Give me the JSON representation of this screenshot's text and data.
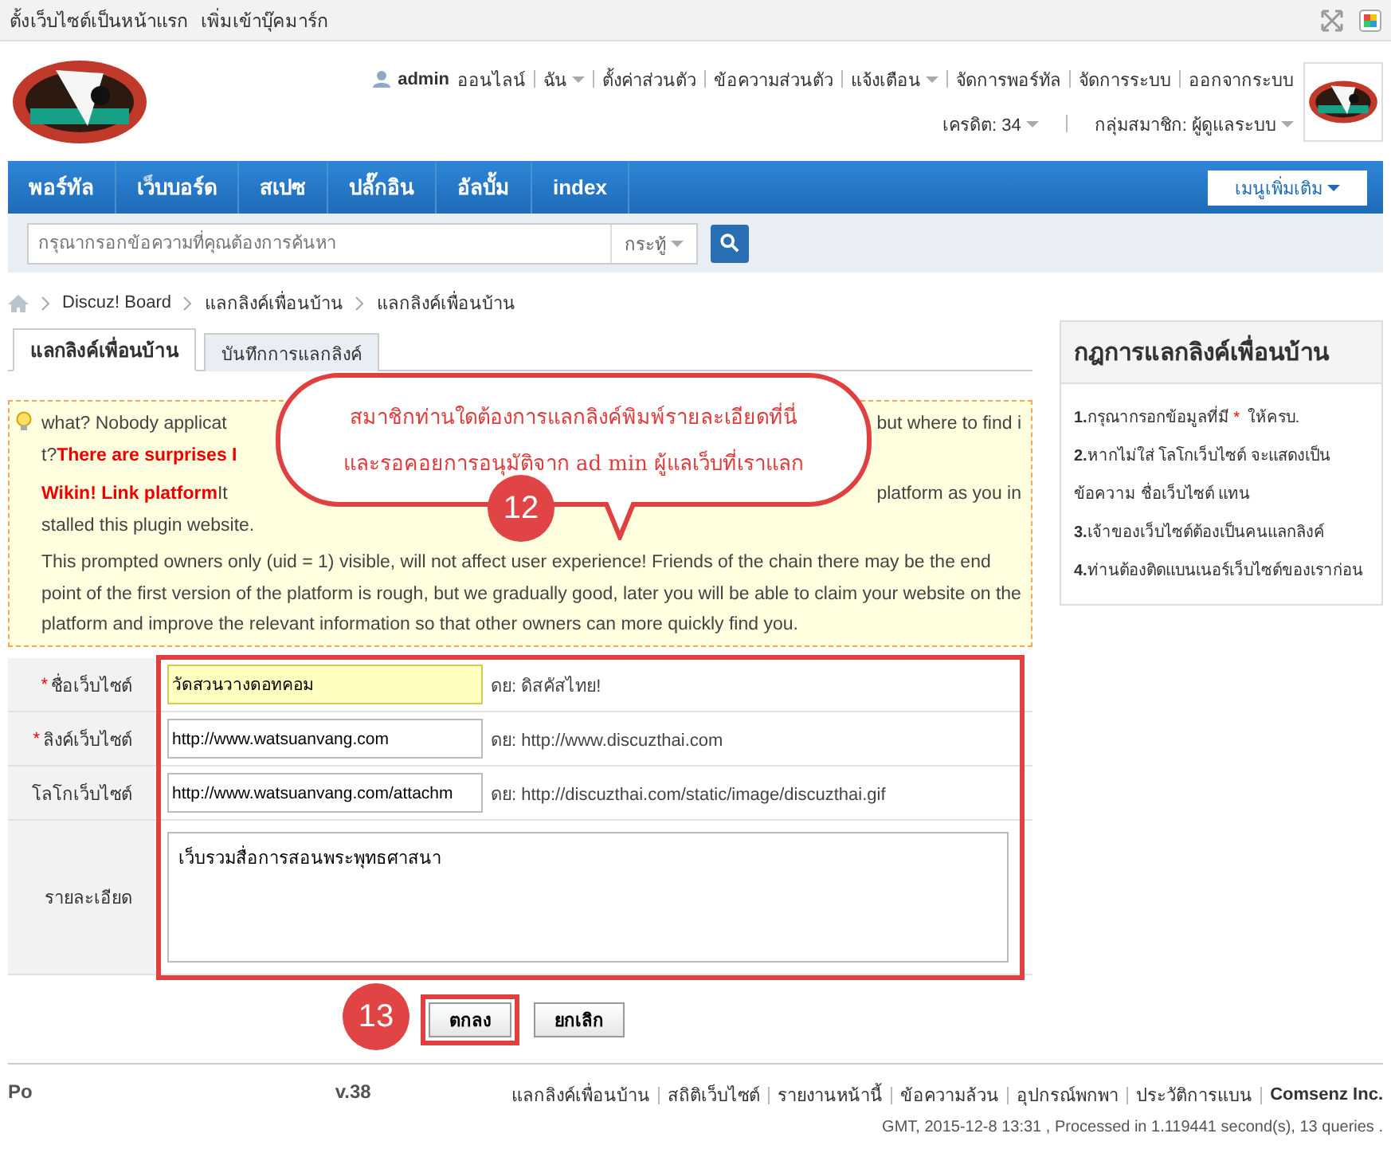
{
  "top_bar": {
    "links": [
      "ตั้งเว็บไซต์เป็นหน้าแรก",
      "เพิ่มเข้าบุ๊คมาร์ก"
    ]
  },
  "user_bar": {
    "username": "admin",
    "status": "ออนไลน์",
    "links": [
      {
        "label": "ฉัน",
        "dropdown": true
      },
      {
        "label": "ตั้งค่าส่วนตัว",
        "dropdown": false
      },
      {
        "label": "ข้อความส่วนตัว",
        "dropdown": false
      },
      {
        "label": "แจ้งเตือน",
        "dropdown": true
      },
      {
        "label": "จัดการพอร์ทัล",
        "dropdown": false
      },
      {
        "label": "จัดการระบบ",
        "dropdown": false
      },
      {
        "label": "ออกจากระบบ",
        "dropdown": false
      }
    ],
    "credit": "เครดิต: 34",
    "group": "กลุ่มสมาชิก: ผู้ดูแลระบบ"
  },
  "nav": {
    "items": [
      "พอร์ทัล",
      "เว็บบอร์ด",
      "สเปซ",
      "ปลั๊กอิน",
      "อัลบั้ม",
      "index"
    ],
    "more": "เมนูเพิ่มเติม"
  },
  "search": {
    "placeholder": "กรุณากรอกข้อความที่คุณต้องการค้นหา",
    "scope": "กระทู้"
  },
  "breadcrumb": [
    "Discuz! Board",
    "แลกลิงค์เพื่อนบ้าน",
    "แลกลิงค์เพื่อนบ้าน"
  ],
  "tabs": [
    {
      "label": "แลกลิงค์เพื่อนบ้าน",
      "selected": true
    },
    {
      "label": "บันทึกการแลกลิงค์",
      "selected": false
    }
  ],
  "notice": {
    "lines": [
      {
        "left": "what? Nobody applicat",
        "right": "but where to find i"
      },
      {
        "left": "t?",
        "left_strong": "There are surprises I"
      },
      {
        "left_strong_first": "Wikin! Link platform",
        "left": "It",
        "right": "platform as you in"
      },
      {
        "left": "stalled this plugin website."
      }
    ],
    "paragraph": "This prompted owners only (uid = 1) visible, will not affect user experience! Friends of the chain there may be the end point of the first version of the platform is rough, but we gradually good, later you will be able to claim your website on the platform and improve the relevant information so that other owners can more quickly find you."
  },
  "form": {
    "rows": [
      {
        "kind": "input",
        "label": "ชื่อเว็บไซต์",
        "required": true,
        "value": "วัดสวนวางดอทคอม",
        "highlighted": true,
        "hint": "ดย: ดิสคัสไทย!"
      },
      {
        "kind": "input",
        "label": "ลิงค์เว็บไซต์",
        "required": true,
        "value": "http://www.watsuanvang.com",
        "highlighted": false,
        "hint": "ดย: http://www.discuzthai.com"
      },
      {
        "kind": "input",
        "label": "โลโกเว็บไซต์",
        "required": false,
        "value": "http://www.watsuanvang.com/attachm",
        "highlighted": false,
        "hint": "ดย: http://discuzthai.com/static/image/discuzthai.gif"
      },
      {
        "kind": "textarea",
        "label": "รายละเอียด",
        "required": false,
        "value": "เว็บรวมสื่อการสอนพระพุทธศาสนา",
        "highlighted": false
      }
    ],
    "buttons": [
      {
        "label": "ตกลง",
        "marked": true
      },
      {
        "label": "ยกเลิก",
        "marked": false
      }
    ]
  },
  "sidebar": {
    "title": "กฎการแลกลิงค์เพื่อนบ้าน",
    "rules": [
      {
        "number": "1.",
        "text": "กรุณากรอกข้อมูลที่มี",
        "mark": "*",
        "text_after": "ให้ครบ."
      },
      {
        "number": "2.",
        "text": "หากไม่ใส่ โลโกเว็บไซต์ จะแสดงเป็นข้อความ ชื่อเว็บไซต์ แทน"
      },
      {
        "number": "3.",
        "text": "เจ้าของเว็บไซต์ต้องเป็นคนแลกลิงค์"
      },
      {
        "number": "4.",
        "text": "ท่านต้องติดแบนเนอร์เว็บไซต์ของเราก่อน"
      }
    ]
  },
  "annotations": {
    "callout": [
      "สมาชิกท่านใดต้องการแลกลิงค์พิมพ์รายละเอียดที่นี่",
      "และรอคอยการอนุมัติจาก ad min ผู้แลเว็บที่เราแลก"
    ],
    "badges": [
      "12",
      "13"
    ]
  },
  "footer": {
    "left": [
      "Po",
      "v.38"
    ],
    "links": [
      "แลกลิงค์เพื่อนบ้าน",
      "สถิติเว็บไซต์",
      "รายงานหน้านี้",
      "ข้อความล้วน",
      "อุปกรณ์พกพา",
      "ประวัติการแบน"
    ],
    "brand": "Comsenz Inc.",
    "stats": "GMT, 2015-12-8 13:31 , Processed in 1.119441 second(s), 13 queries ."
  }
}
